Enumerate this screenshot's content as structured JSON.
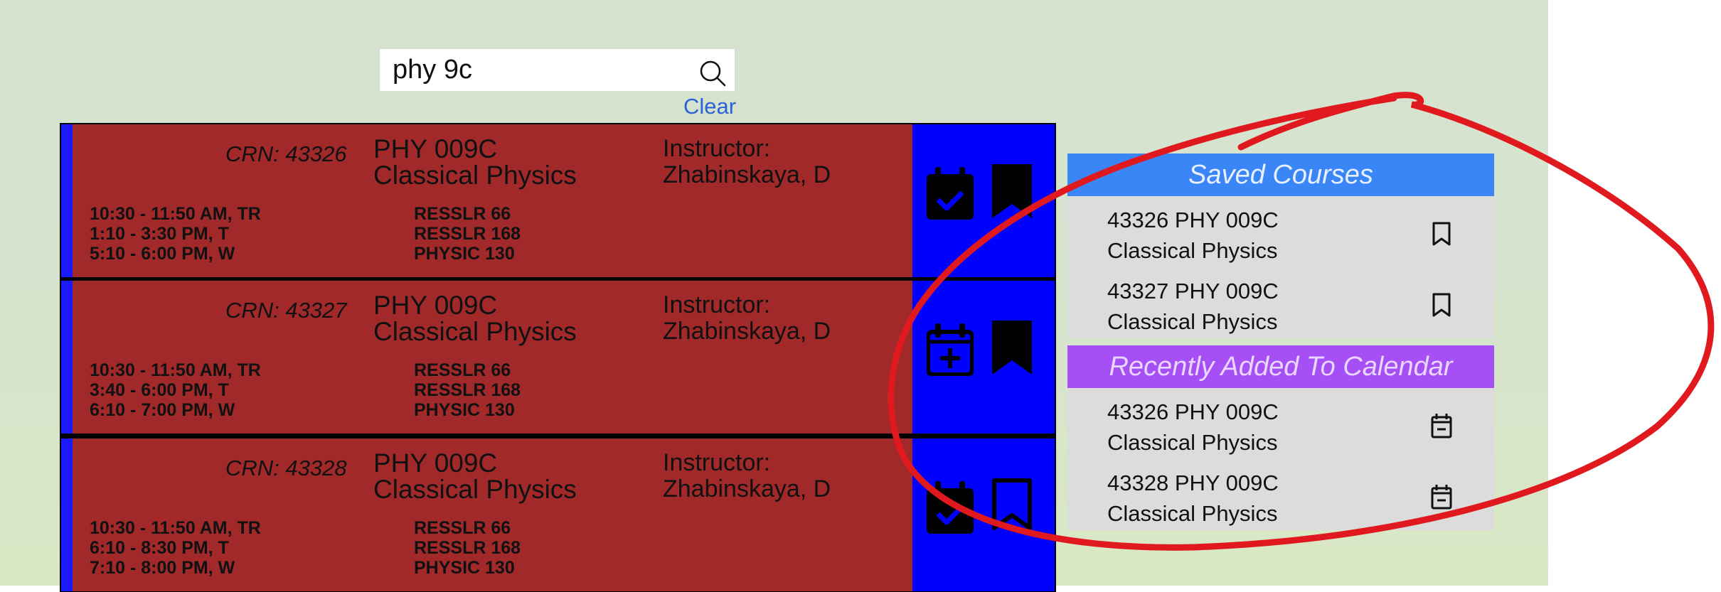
{
  "search": {
    "value": "phy 9c",
    "clear_label": "Clear"
  },
  "results": [
    {
      "crn": "CRN: 43326",
      "code": "PHY 009C",
      "title": "Classical Physics",
      "instructor_label": "Instructor:",
      "instructor": "Zhabinskaya, D",
      "times": [
        "10:30 - 11:50 AM, TR",
        "1:10 - 3:30 PM, T",
        "5:10 - 6:00 PM, W"
      ],
      "rooms": [
        "RESSLR 66",
        "RESSLR 168",
        "PHYSIC 130"
      ],
      "calendar_icon": "calendar-check-icon",
      "bookmark_icon": "bookmark-filled-icon"
    },
    {
      "crn": "CRN: 43327",
      "code": "PHY 009C",
      "title": "Classical Physics",
      "instructor_label": "Instructor:",
      "instructor": "Zhabinskaya, D",
      "times": [
        "10:30 - 11:50 AM, TR",
        "3:40 - 6:00 PM, T",
        "6:10 - 7:00 PM, W"
      ],
      "rooms": [
        "RESSLR 66",
        "RESSLR 168",
        "PHYSIC 130"
      ],
      "calendar_icon": "calendar-plus-icon",
      "bookmark_icon": "bookmark-filled-icon"
    },
    {
      "crn": "CRN: 43328",
      "code": "PHY 009C",
      "title": "Classical Physics",
      "instructor_label": "Instructor:",
      "instructor": "Zhabinskaya, D",
      "times": [
        "10:30 - 11:50 AM, TR",
        "6:10 - 8:30 PM, T",
        "7:10 - 8:00 PM, W"
      ],
      "rooms": [
        "RESSLR 66",
        "RESSLR 168",
        "PHYSIC 130"
      ],
      "calendar_icon": "calendar-check-icon",
      "bookmark_icon": "bookmark-outline-icon"
    }
  ],
  "sidebar": {
    "saved_title": "Saved Courses",
    "saved": [
      {
        "line1": "43326 PHY 009C",
        "line2": "Classical Physics",
        "icon": "bookmark-outline-icon"
      },
      {
        "line1": "43327 PHY 009C",
        "line2": "Classical Physics",
        "icon": "bookmark-outline-icon"
      }
    ],
    "recent_title": "Recently Added To Calendar",
    "recent": [
      {
        "line1": "43326 PHY 009C",
        "line2": "Classical Physics",
        "icon": "calendar-minus-icon"
      },
      {
        "line1": "43328 PHY 009C",
        "line2": "Classical Physics",
        "icon": "calendar-minus-icon"
      }
    ]
  },
  "colors": {
    "background": "#d6e2d0",
    "card": "#a1292a",
    "actions": "#0000ff",
    "saved_header": "#3b86f6",
    "recent_header": "#a64ff5",
    "sidebar_list": "#dcdcdc",
    "link": "#2a63d6",
    "annotation": "#e0191e"
  }
}
